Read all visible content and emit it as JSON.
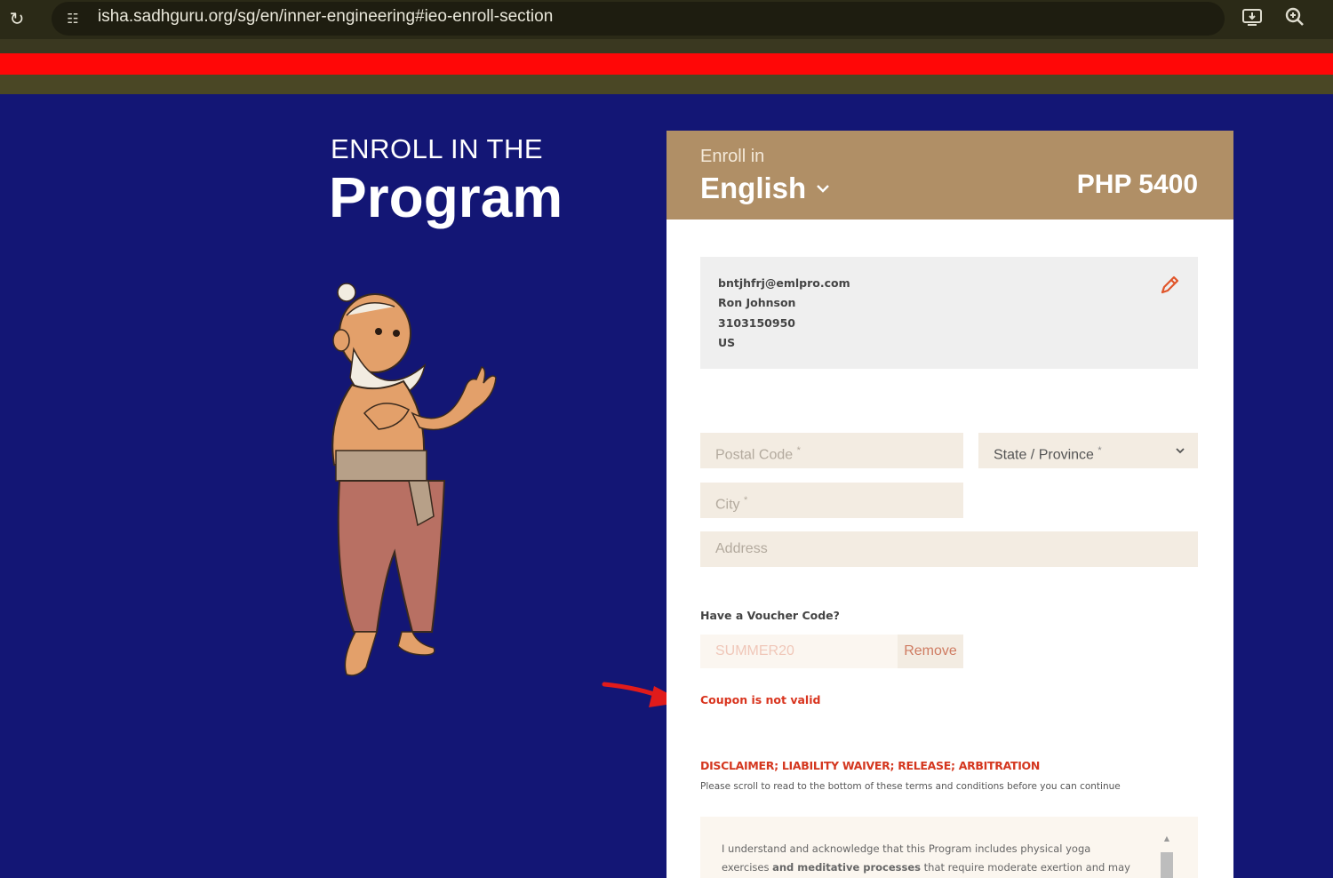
{
  "browser": {
    "url": "isha.sadhguru.org/sg/en/inner-engineering#ieo-enroll-section",
    "icons": [
      "reload-icon",
      "site-settings-icon",
      "install-app-icon",
      "zoom-icon"
    ]
  },
  "hero": {
    "subtitle": "ENROLL IN THE",
    "title": "Program"
  },
  "enroll": {
    "label": "Enroll in",
    "language": "English",
    "price": "PHP 5400"
  },
  "user": {
    "email": "bntjhfrj@emlpro.com",
    "name": "Ron Johnson",
    "phone": "3103150950",
    "country": "US"
  },
  "form": {
    "postal_placeholder": "Postal Code",
    "state_label": "State / Province",
    "city_placeholder": "City",
    "address_placeholder": "Address",
    "required_mark": "*"
  },
  "voucher": {
    "label": "Have a Voucher Code?",
    "value": "SUMMER20",
    "remove_label": "Remove",
    "error": "Coupon is not valid"
  },
  "disclaimer": {
    "title": "DISCLAIMER; LIABILITY WAIVER; RELEASE; ARBITRATION",
    "note": "Please scroll to read to the bottom of these terms and conditions before you can continue",
    "text_line1": "I understand and acknowledge that this Program includes physical yoga",
    "text_line2_a": "exercises ",
    "text_line2_b": "and meditative processes",
    "text_line2_c": " that require moderate exertion and may"
  },
  "colors": {
    "page_bg": "#131675",
    "card_header": "#b08f66",
    "error_red": "#d9351f",
    "highlight_bar": "#ff0707"
  }
}
